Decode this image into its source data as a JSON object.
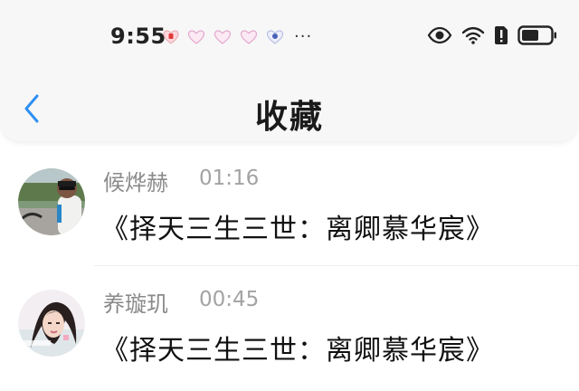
{
  "status_bar": {
    "time": "9:55",
    "notification_icons": [
      "red-badge-icon",
      "heart-icon",
      "heart-icon",
      "heart-icon",
      "gift-heart-icon"
    ],
    "more_indicator": "···",
    "system_icons": [
      "eye-icon",
      "wifi-icon",
      "sim-alert-icon",
      "battery-icon"
    ]
  },
  "header": {
    "back_icon": "chevron-left-icon",
    "title": "收藏"
  },
  "favorites": [
    {
      "sender": "候烨赫",
      "time": "01:16",
      "title": "《择天三生三世：离卿慕华宸》",
      "avatar": "avatar-photo-man"
    },
    {
      "sender": "养璇玑",
      "time": "00:45",
      "title": "《择天三生三世：离卿慕华宸》",
      "avatar": "avatar-photo-woman"
    }
  ],
  "colors": {
    "accent": "#2f8ff2",
    "title_text": "#1a1a1a",
    "secondary_text": "#8a8a8a",
    "header_bg": "#f7f7f7"
  }
}
